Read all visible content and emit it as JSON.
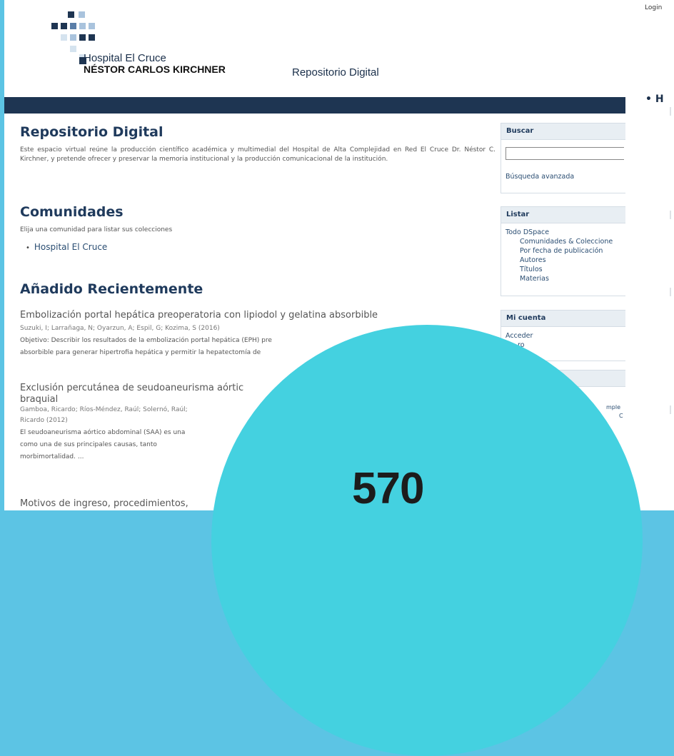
{
  "header": {
    "hospital_name": "Hospital El Cruce",
    "hospital_subtitle": "NÉSTOR CARLOS KIRCHNER",
    "repo_title": "Repositorio Digital",
    "login": "Login",
    "logo_colors": {
      "dark": "#1e3552",
      "mid": "#5a7ea8",
      "light": "#a9c3dd",
      "pale": "#d5e3ef"
    }
  },
  "main": {
    "title": "Repositorio Digital",
    "intro": "Este espacio virtual reúne la producción científico académica y multimedial del Hospital de Alta Complejidad en Red El Cruce Dr. Néstor C. Kirchner, y pretende ofrecer y preservar la memoria institucional y la producción comunicacional de la institución.",
    "communities": {
      "heading": "Comunidades",
      "description": "Elija una comunidad para listar sus colecciones",
      "items": [
        "Hospital El Cruce"
      ]
    },
    "recent": {
      "heading": "Añadido Recientemente",
      "items": [
        {
          "title": "Embolización portal hepática preoperatoria con lipiodol y gelatina absorbible",
          "authors": "Suzuki, I; Larrañaga, N; Oyarzun, A; Espil, G; Kozima, S (2016)",
          "abstract_line1": "Objetivo: Describir los resultados de la embolización portal hepática (EPH) pre",
          "abstract_line2": "absorbible para generar hipertrofia hepática y permitir la hepatectomía de"
        },
        {
          "title_line1": "Exclusión percutánea de seudoaneurisma aórtic",
          "title_line2": "braquial",
          "authors_line1": "Gamboa, Ricardo; Ríos-Méndez, Raúl; Solernó, Raúl;",
          "authors_line2": "Ricardo (2012)",
          "abstract_line1": "El seudoaneurisma aórtico abdominal (SAA) es una",
          "abstract_line2": "como una de sus principales causas, tanto",
          "abstract_line3": "morbimortalidad. ..."
        },
        {
          "title": "Motivos de ingreso, procedimientos,"
        }
      ]
    }
  },
  "sidebar": {
    "search": {
      "heading": "Buscar",
      "value": "",
      "advanced": "Búsqueda avanzada"
    },
    "browse": {
      "heading": "Listar",
      "root": "Todo DSpace",
      "links": [
        "Comunidades & Coleccione",
        "Por fecha de publicación",
        "Autores",
        "Títulos",
        "Materias"
      ]
    },
    "account": {
      "heading": "Mi cuenta",
      "links": [
        "Acceder",
        "ro"
      ]
    },
    "partial": [
      "mple",
      "C"
    ]
  },
  "right_panel": {
    "bullet": "• H"
  },
  "overlay": {
    "number": "570",
    "color": "#44d1e0"
  }
}
